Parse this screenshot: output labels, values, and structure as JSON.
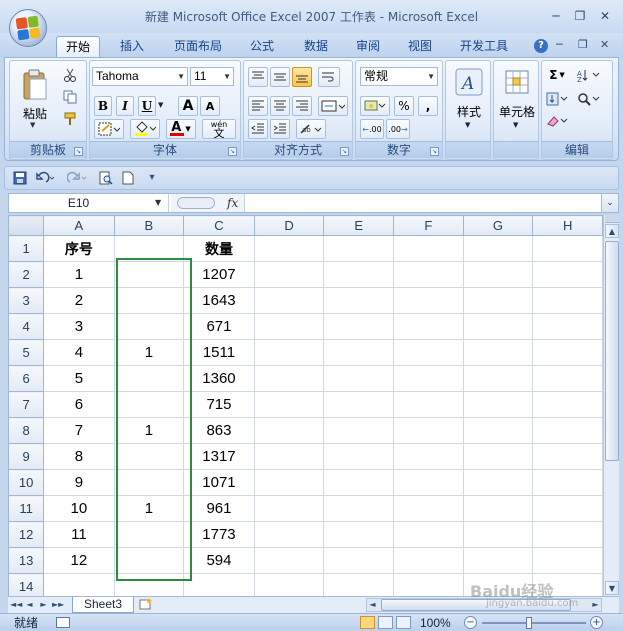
{
  "window": {
    "title": "新建 Microsoft Office Excel 2007 工作表 - Microsoft Excel",
    "controls": {
      "minimize": "─",
      "restore": "❐",
      "close": "✕"
    },
    "ribbon_controls": {
      "help": "?",
      "minimize": "─",
      "restore": "❐",
      "close": "✕"
    }
  },
  "tabs": [
    "开始",
    "插入",
    "页面布局",
    "公式",
    "数据",
    "审阅",
    "视图",
    "开发工具"
  ],
  "ribbon": {
    "clipboard": {
      "paste_label": "粘贴",
      "group_label": "剪贴板"
    },
    "font": {
      "font_name": "Tahoma",
      "font_size": "11",
      "bold": "B",
      "italic": "I",
      "underline": "U",
      "grow": "A",
      "shrink": "A",
      "font_color_glyph": "A",
      "phonetic": "wén",
      "group_label": "字体"
    },
    "alignment": {
      "group_label": "对齐方式"
    },
    "number": {
      "format": "常规",
      "percent": "%",
      "comma": ",",
      "group_label": "数字",
      "dec_inc": ".00",
      "dec_dec": ".00"
    },
    "styles": {
      "label": "样式"
    },
    "cells": {
      "label": "单元格"
    },
    "editing": {
      "sigma": "Σ",
      "group_label": "编辑"
    }
  },
  "namebox": "E10",
  "fx": "fx",
  "formula": "",
  "columns": [
    "A",
    "B",
    "C",
    "D",
    "E",
    "F",
    "G",
    "H"
  ],
  "rows": [
    {
      "num": "1",
      "cells": [
        "序号",
        "",
        "数量",
        "",
        "",
        "",
        "",
        ""
      ]
    },
    {
      "num": "2",
      "cells": [
        "1",
        "",
        "1207",
        "",
        "",
        "",
        "",
        ""
      ]
    },
    {
      "num": "3",
      "cells": [
        "2",
        "",
        "1643",
        "",
        "",
        "",
        "",
        ""
      ]
    },
    {
      "num": "4",
      "cells": [
        "3",
        "",
        "671",
        "",
        "",
        "",
        "",
        ""
      ]
    },
    {
      "num": "5",
      "cells": [
        "4",
        "1",
        "1511",
        "",
        "",
        "",
        "",
        ""
      ]
    },
    {
      "num": "6",
      "cells": [
        "5",
        "",
        "1360",
        "",
        "",
        "",
        "",
        ""
      ]
    },
    {
      "num": "7",
      "cells": [
        "6",
        "",
        "715",
        "",
        "",
        "",
        "",
        ""
      ]
    },
    {
      "num": "8",
      "cells": [
        "7",
        "1",
        "863",
        "",
        "",
        "",
        "",
        ""
      ]
    },
    {
      "num": "9",
      "cells": [
        "8",
        "",
        "1317",
        "",
        "",
        "",
        "",
        ""
      ]
    },
    {
      "num": "10",
      "cells": [
        "9",
        "",
        "1071",
        "",
        "",
        "",
        "",
        ""
      ]
    },
    {
      "num": "11",
      "cells": [
        "10",
        "1",
        "961",
        "",
        "",
        "",
        "",
        ""
      ]
    },
    {
      "num": "12",
      "cells": [
        "11",
        "",
        "1773",
        "",
        "",
        "",
        "",
        ""
      ]
    },
    {
      "num": "13",
      "cells": [
        "12",
        "",
        "594",
        "",
        "",
        "",
        "",
        ""
      ]
    },
    {
      "num": "14",
      "cells": [
        "",
        "",
        "",
        "",
        "",
        "",
        "",
        ""
      ]
    }
  ],
  "sheet_tabs": [
    "Sheet3"
  ],
  "status": {
    "ready": "就绪",
    "zoom": "100%",
    "zoom_out": "−",
    "zoom_in": "+"
  },
  "watermark": {
    "main": "Baidu经验",
    "sub": "jingyan.baidu.com"
  },
  "colors": {
    "highlight_box": "#2d8a3e",
    "accent": "#15428b"
  },
  "icons": {
    "office": "office-logo",
    "nav": [
      "◄◄",
      "◄",
      "►",
      "►►"
    ],
    "scroll_up": "▲",
    "scroll_down": "▼",
    "scroll_left": "◄",
    "scroll_right": "►"
  }
}
